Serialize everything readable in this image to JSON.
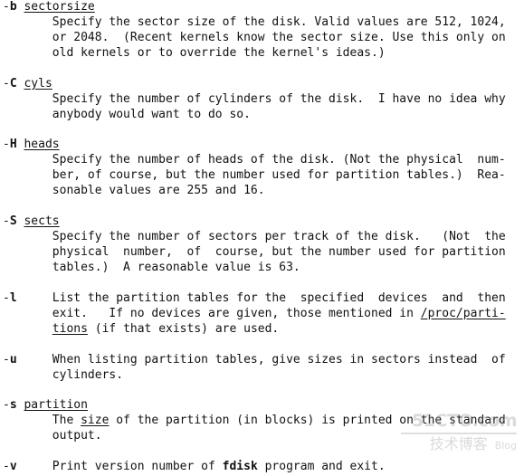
{
  "lines": [
    [
      [
        "-",
        "n"
      ],
      [
        "b",
        "b"
      ],
      [
        " ",
        "n"
      ],
      [
        "sectorsize",
        "u"
      ]
    ],
    [
      [
        "       Specify the sector size of the disk. Valid values are 512, 1024,",
        "n"
      ]
    ],
    [
      [
        "       or 2048.  (Recent kernels know the sector size. Use this only on",
        "n"
      ]
    ],
    [
      [
        "       old kernels or to override the kernel's ideas.)",
        "n"
      ]
    ],
    [],
    [
      [
        "-",
        "n"
      ],
      [
        "C",
        "b"
      ],
      [
        " ",
        "n"
      ],
      [
        "cyls",
        "u"
      ]
    ],
    [
      [
        "       Specify the number of cylinders of the disk.  I have no idea why",
        "n"
      ]
    ],
    [
      [
        "       anybody would want to do so.",
        "n"
      ]
    ],
    [],
    [
      [
        "-",
        "n"
      ],
      [
        "H",
        "b"
      ],
      [
        " ",
        "n"
      ],
      [
        "heads",
        "u"
      ]
    ],
    [
      [
        "       Specify the number of heads of the disk. (Not the physical  num-",
        "n"
      ]
    ],
    [
      [
        "       ber, of course, but the number used for partition tables.)  Rea-",
        "n"
      ]
    ],
    [
      [
        "       sonable values are 255 and 16.",
        "n"
      ]
    ],
    [],
    [
      [
        "-",
        "n"
      ],
      [
        "S",
        "b"
      ],
      [
        " ",
        "n"
      ],
      [
        "sects",
        "u"
      ]
    ],
    [
      [
        "       Specify the number of sectors per track of the disk.   (Not  the",
        "n"
      ]
    ],
    [
      [
        "       physical  number,  of  course, but the number used for partition",
        "n"
      ]
    ],
    [
      [
        "       tables.)  A reasonable value is 63.",
        "n"
      ]
    ],
    [],
    [
      [
        "-",
        "n"
      ],
      [
        "l",
        "b"
      ],
      [
        "     List the partition tables for the  specified  devices  and  then",
        "n"
      ]
    ],
    [
      [
        "       exit.   If no devices are given, those mentioned in ",
        "n"
      ],
      [
        "/proc/parti-",
        "u"
      ]
    ],
    [
      [
        "       ",
        "n"
      ],
      [
        "tions",
        "u"
      ],
      [
        " (if that exists) are used.",
        "n"
      ]
    ],
    [],
    [
      [
        "-",
        "n"
      ],
      [
        "u",
        "b"
      ],
      [
        "     When listing partition tables, give sizes in sectors instead  of",
        "n"
      ]
    ],
    [
      [
        "       cylinders.",
        "n"
      ]
    ],
    [],
    [
      [
        "-",
        "n"
      ],
      [
        "s",
        "b"
      ],
      [
        " ",
        "n"
      ],
      [
        "partition",
        "u"
      ]
    ],
    [
      [
        "       The ",
        "n"
      ],
      [
        "size",
        "u"
      ],
      [
        " of the partition (in blocks) is printed on the standard",
        "n"
      ]
    ],
    [
      [
        "       output.",
        "n"
      ]
    ],
    [],
    [
      [
        "-",
        "n"
      ],
      [
        "v",
        "b"
      ],
      [
        "     Print version number of ",
        "n"
      ],
      [
        "fdisk",
        "b"
      ],
      [
        " program and exit.",
        "n"
      ]
    ]
  ],
  "watermark": {
    "site": "51CTO.com",
    "sub": "技术博客",
    "blog": "Blog"
  }
}
